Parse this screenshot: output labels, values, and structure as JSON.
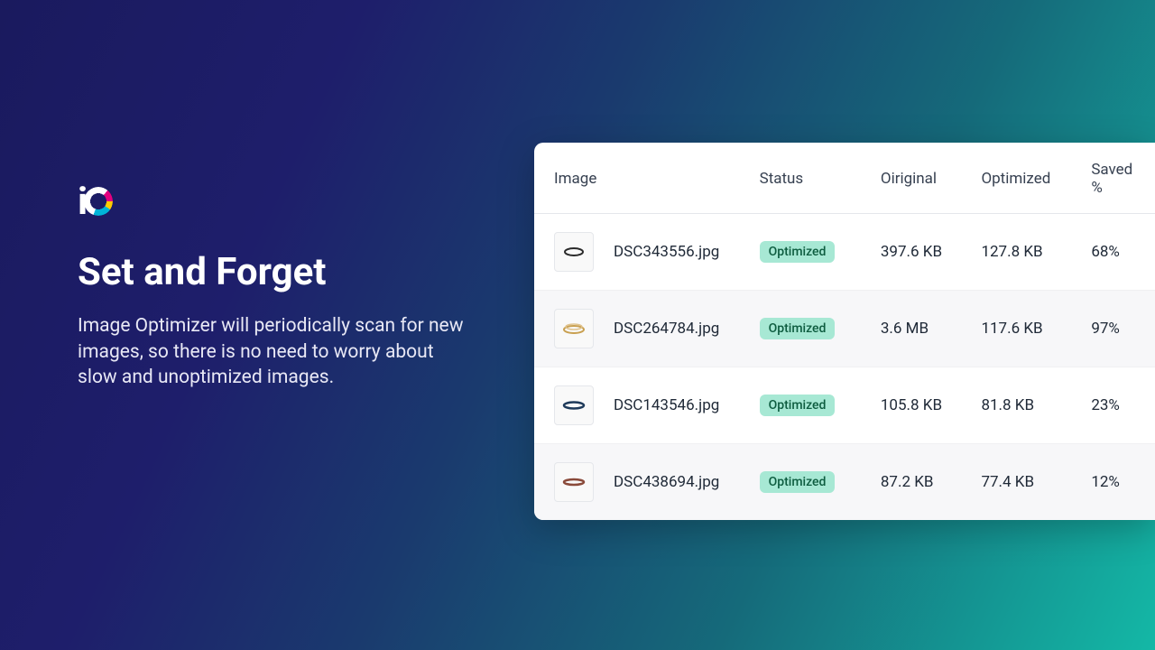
{
  "hero": {
    "heading": "Set and Forget",
    "description": "Image Optimizer will periodically scan for new images, so there is no need to worry about slow and unoptimized images."
  },
  "table": {
    "headers": {
      "image": "Image",
      "status": "Status",
      "original": "Oiriginal",
      "optimized": "Optimized",
      "saved": "Saved %"
    },
    "rows": [
      {
        "filename": "DSC343556.jpg",
        "status": "Optimized",
        "original": "397.6 KB",
        "optimized": "127.8 KB",
        "saved": "68%"
      },
      {
        "filename": "DSC264784.jpg",
        "status": "Optimized",
        "original": "3.6 MB",
        "optimized": "117.6 KB",
        "saved": "97%"
      },
      {
        "filename": "DSC143546.jpg",
        "status": "Optimized",
        "original": "105.8 KB",
        "optimized": "81.8 KB",
        "saved": "23%"
      },
      {
        "filename": "DSC438694.jpg",
        "status": "Optimized",
        "original": "87.2 KB",
        "optimized": "77.4 KB",
        "saved": "12%"
      }
    ]
  }
}
